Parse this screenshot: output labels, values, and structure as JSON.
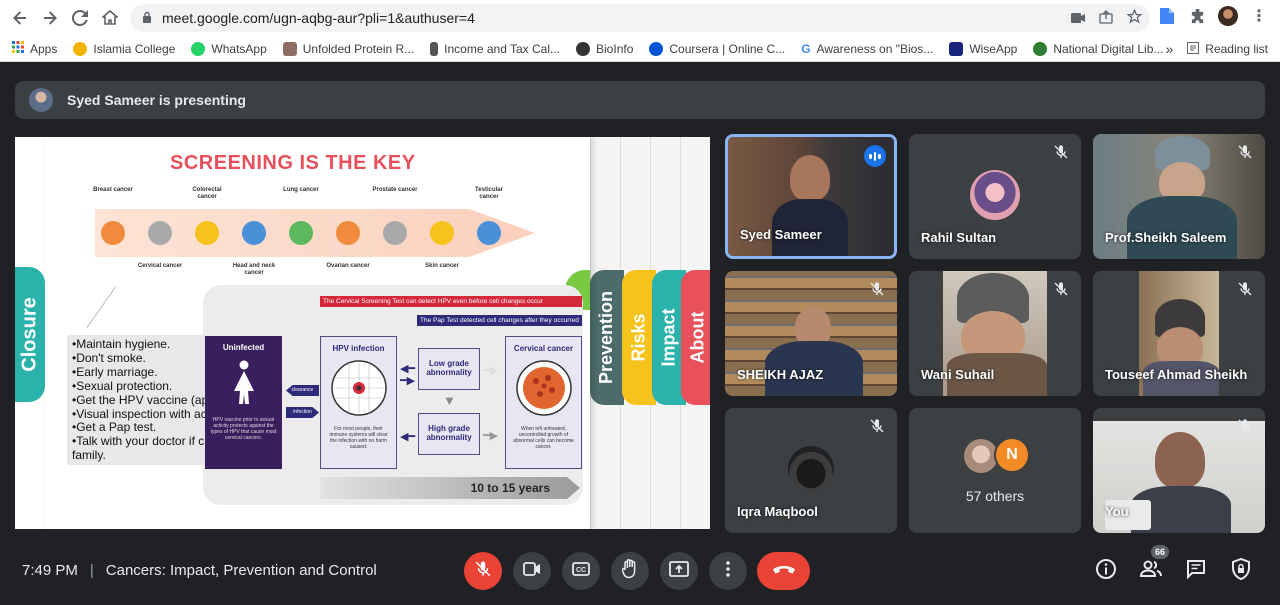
{
  "browser": {
    "url": "meet.google.com/ugn-aqbg-aur?pli=1&authuser=4",
    "bookmarks": [
      {
        "label": "Apps",
        "color": "#4285f4"
      },
      {
        "label": "Islamia College",
        "color": "#f2b400"
      },
      {
        "label": "WhatsApp",
        "color": "#25d366"
      },
      {
        "label": "Unfolded Protein R...",
        "color": "#8d6e63"
      },
      {
        "label": "Income and Tax Cal...",
        "color": "#555555"
      },
      {
        "label": "BioInfo",
        "color": "#333333"
      },
      {
        "label": "Coursera | Online C...",
        "color": "#0056d2"
      },
      {
        "label": "Awareness on \"Bios...",
        "color": "#4285f4"
      },
      {
        "label": "WiseApp",
        "color": "#1a237e"
      },
      {
        "label": "National Digital Lib...",
        "color": "#2e7d32"
      }
    ],
    "more_label": "»",
    "reading_list": "Reading list"
  },
  "presenting": {
    "text": "Syed Sameer is presenting"
  },
  "slide": {
    "title": "SCREENING IS THE KEY",
    "top_labels": [
      "Breast cancer",
      "Colorectal cancer",
      "Lung cancer",
      "Prostate cancer",
      "Testicular cancer"
    ],
    "bottom_labels": [
      "Cervical cancer",
      "Head and neck cancer",
      "Ovarian cancer",
      "Skin cancer"
    ],
    "dot_colors": [
      "#f08a3c",
      "#a9a9a9",
      "#f6c21c",
      "#4a90d9",
      "#5cb85c",
      "#f08a3c",
      "#a9a9a9",
      "#f6c21c",
      "#4a90d9"
    ],
    "bullets": [
      "•Maintain hygiene.",
      "•Don't smoke.",
      "•Early marriage.",
      "•Sexual protection.",
      "•Get the HPV vaccine (app",
      "•Visual inspection with ac",
      "•Get a Pap test.",
      "•Talk with your doctor if c",
      "family."
    ],
    "red_bar": "The Cervical Screening Test can detect HPV even before cell changes occur",
    "blue_bar": "The Pap Test detected cell changes after they occurred",
    "uninfected_title": "Uninfected",
    "uninfected_note": "HPV vaccine prior to sexual activity protects against the types of HPV that cause most cervical cancers.",
    "clearance": "clearance",
    "infection": "infection",
    "hpv_title": "HPV infection",
    "hpv_note": "For most people, their immune systems will clear the infection with no harm caused.",
    "low_grade": "Low grade abnormality",
    "high_grade": "High grade abnormality",
    "cervical_title": "Cervical cancer",
    "cervical_note": "When left untreated, uncontrolled growth of abnormal cells can become cancer.",
    "years": "10 to 15 years",
    "tabs": {
      "closure": "Closure",
      "prevention": "Prevention",
      "risks": "Risks",
      "impact": "Impact",
      "about": "About"
    }
  },
  "participants": [
    {
      "name": "Syed Sameer",
      "active": true
    },
    {
      "name": "Rahil Sultan",
      "active": false
    },
    {
      "name": "Prof.Sheikh Saleem",
      "active": false
    },
    {
      "name": "SHEIKH AJAZ",
      "active": false
    },
    {
      "name": "Wani Suhail",
      "active": false
    },
    {
      "name": "Touseef Ahmad Sheikh",
      "active": false
    },
    {
      "name": "Iqra Maqbool",
      "active": false
    },
    {
      "name": "57 others",
      "initial": "N",
      "active": false
    },
    {
      "name": "You",
      "active": false
    }
  ],
  "bottom": {
    "time": "7:49 PM",
    "separator": "|",
    "meeting_title": "Cancers: Impact, Prevention and Control",
    "people_count": "66"
  }
}
